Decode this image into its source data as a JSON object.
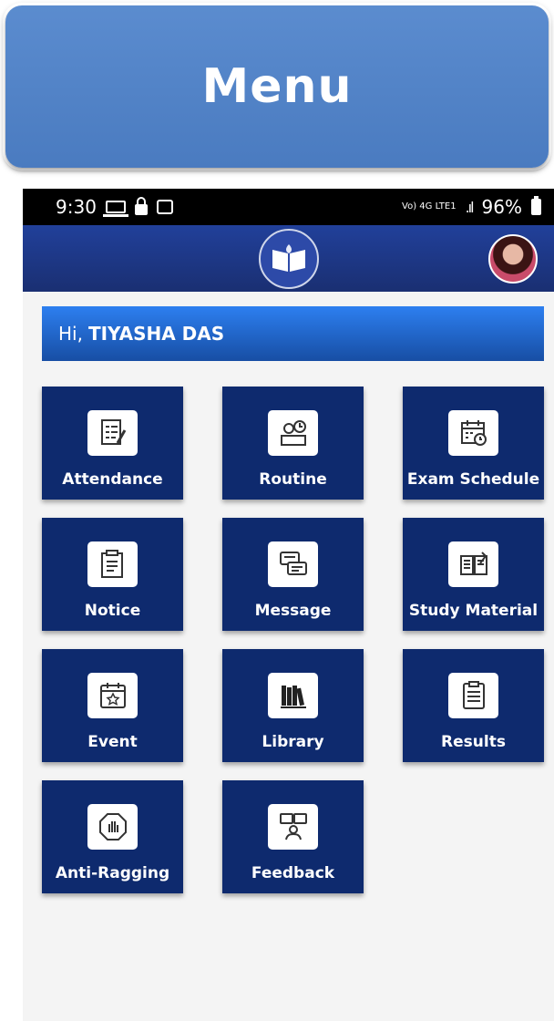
{
  "banner": {
    "title": "Menu"
  },
  "status_bar": {
    "time": "9:30",
    "network": "Vo) 4G LTE1",
    "battery": "96%"
  },
  "greeting": {
    "prefix": "Hi,",
    "name": "TIYASHA DAS"
  },
  "menu": [
    {
      "label": "Attendance",
      "icon": "attendance-icon"
    },
    {
      "label": "Routine",
      "icon": "routine-icon"
    },
    {
      "label": "Exam Schedule",
      "icon": "calendar-icon"
    },
    {
      "label": "Notice",
      "icon": "notice-icon"
    },
    {
      "label": "Message",
      "icon": "message-icon"
    },
    {
      "label": "Study Material",
      "icon": "book-icon"
    },
    {
      "label": "Event",
      "icon": "event-icon"
    },
    {
      "label": "Library",
      "icon": "library-icon"
    },
    {
      "label": "Results",
      "icon": "results-icon"
    },
    {
      "label": "Anti-Ragging",
      "icon": "stop-hand-icon"
    },
    {
      "label": "Feedback",
      "icon": "feedback-icon"
    }
  ],
  "colors": {
    "tile": "#0e2a6e",
    "appbar": "#21409a",
    "banner": "#5b8ccf"
  }
}
